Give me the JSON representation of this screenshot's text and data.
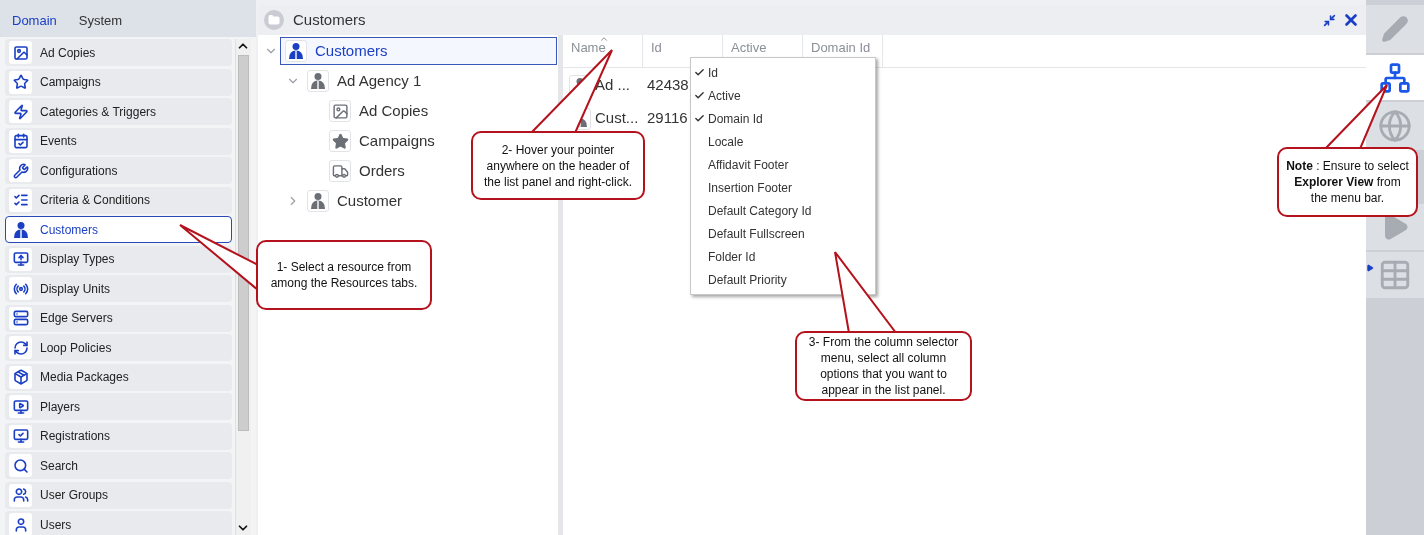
{
  "sidebar": {
    "tabs": [
      {
        "label": "Domain",
        "selected": true
      },
      {
        "label": "System",
        "selected": false
      }
    ],
    "items": [
      {
        "label": "Ad Copies",
        "selected": false
      },
      {
        "label": "Campaigns",
        "selected": false
      },
      {
        "label": "Categories & Triggers",
        "selected": false
      },
      {
        "label": "Events",
        "selected": false
      },
      {
        "label": "Configurations",
        "selected": false
      },
      {
        "label": "Criteria & Conditions",
        "selected": false
      },
      {
        "label": "Customers",
        "selected": true
      },
      {
        "label": "Display Types",
        "selected": false
      },
      {
        "label": "Display Units",
        "selected": false
      },
      {
        "label": "Edge Servers",
        "selected": false
      },
      {
        "label": "Loop Policies",
        "selected": false
      },
      {
        "label": "Media Packages",
        "selected": false
      },
      {
        "label": "Players",
        "selected": false
      },
      {
        "label": "Registrations",
        "selected": false
      },
      {
        "label": "Search",
        "selected": false
      },
      {
        "label": "User Groups",
        "selected": false
      },
      {
        "label": "Users",
        "selected": false
      }
    ]
  },
  "panel": {
    "title": "Customers"
  },
  "tree": [
    {
      "label": "Customers",
      "kind": "customer",
      "selected": true,
      "expanded": true,
      "children": [
        {
          "label": "Ad Agency 1",
          "kind": "customer",
          "selected": false,
          "expanded": true,
          "children": [
            {
              "label": "Ad Copies",
              "kind": "ad_copies",
              "selected": false
            },
            {
              "label": "Campaigns",
              "kind": "campaigns",
              "selected": false
            },
            {
              "label": "Orders",
              "kind": "orders",
              "selected": false
            }
          ]
        },
        {
          "label": "Customer",
          "kind": "customer",
          "selected": false,
          "expanded": false
        }
      ]
    }
  ],
  "list": {
    "columns": [
      {
        "label": "Name",
        "sorted": true
      },
      {
        "label": "Id",
        "sorted": false
      },
      {
        "label": "Active",
        "sorted": false
      },
      {
        "label": "Domain Id",
        "sorted": false
      }
    ],
    "rows": [
      {
        "name": "Ad ...",
        "id": "42438"
      },
      {
        "name": "Cust...",
        "id": "29116"
      }
    ]
  },
  "column_menu": {
    "items": [
      {
        "label": "Id",
        "checked": true
      },
      {
        "label": "Active",
        "checked": true
      },
      {
        "label": "Domain Id",
        "checked": true
      },
      {
        "label": "Locale",
        "checked": false
      },
      {
        "label": "Affidavit Footer",
        "checked": false
      },
      {
        "label": "Insertion Footer",
        "checked": false
      },
      {
        "label": "Default Category Id",
        "checked": false
      },
      {
        "label": "Default Fullscreen",
        "checked": false
      },
      {
        "label": "Folder Id",
        "checked": false
      },
      {
        "label": "Default Priority",
        "checked": false
      }
    ]
  },
  "rail": {
    "items": [
      {
        "kind": "edit",
        "selected": false
      },
      {
        "kind": "explorer",
        "selected": true
      },
      {
        "kind": "globe",
        "selected": false
      },
      {
        "kind": "play",
        "selected": false
      },
      {
        "kind": "media",
        "selected": false
      }
    ]
  },
  "callouts": [
    {
      "text": "1- Select a resource from among the Resources tabs."
    },
    {
      "text": "2- Hover your pointer anywhere on the header of the list panel and right-click."
    },
    {
      "text": "3- From the column selector menu, select all column options that you want to appear in the list panel."
    },
    {
      "text": "**Note** : Ensure to select **Explorer View**  from the menu bar."
    }
  ]
}
